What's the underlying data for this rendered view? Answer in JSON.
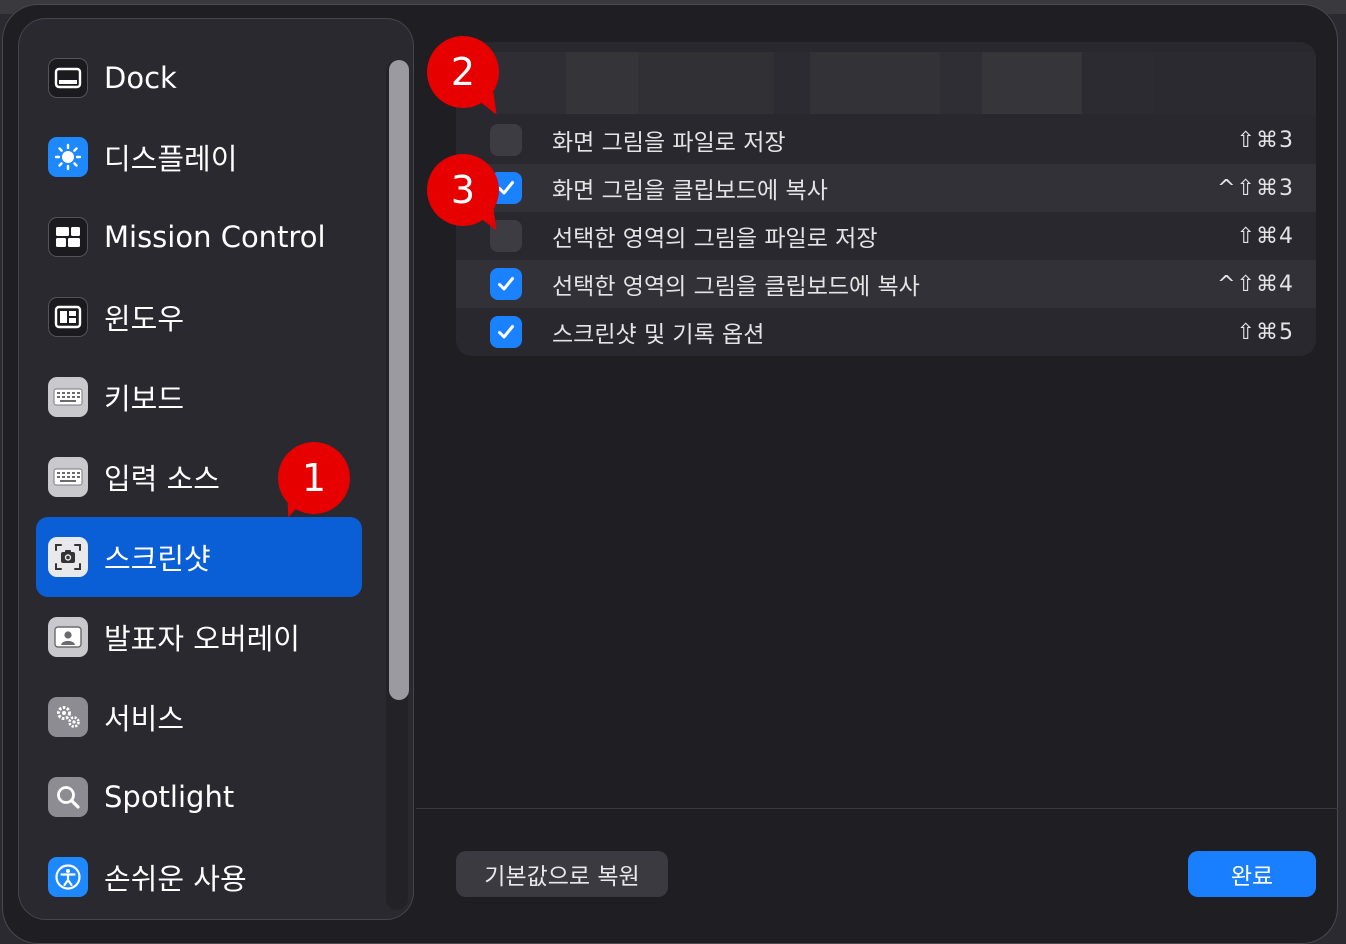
{
  "sidebar": {
    "items": [
      {
        "label": "Dock",
        "icon": "dock-icon",
        "color": "#1b1b1f"
      },
      {
        "label": "디스플레이",
        "icon": "display-brightness-icon",
        "color": "#1e88ff"
      },
      {
        "label": "Mission Control",
        "icon": "mission-control-icon",
        "color": "#1b1b1f"
      },
      {
        "label": "윈도우",
        "icon": "window-icon",
        "color": "#1b1b1f"
      },
      {
        "label": "키보드",
        "icon": "keyboard-icon",
        "color": "#c9c9cd"
      },
      {
        "label": "입력 소스",
        "icon": "keyboard-icon",
        "color": "#c9c9cd"
      },
      {
        "label": "스크린샷",
        "icon": "screenshot-camera-icon",
        "color": "#e9e9ec",
        "selected": true
      },
      {
        "label": "발표자 오버레이",
        "icon": "presenter-overlay-icon",
        "color": "#c9c9cd"
      },
      {
        "label": "서비스",
        "icon": "gears-icon",
        "color": "#8c8c92"
      },
      {
        "label": "Spotlight",
        "icon": "magnifier-icon",
        "color": "#8c8c92"
      },
      {
        "label": "손쉬운 사용",
        "icon": "accessibility-icon",
        "color": "#1e88ff"
      }
    ]
  },
  "shortcuts": {
    "rows": [
      {
        "label": "화면 그림을 파일로 저장",
        "key": "⇧⌘3",
        "checked": false
      },
      {
        "label": "화면 그림을 클립보드에 복사",
        "key": "^⇧⌘3",
        "checked": true
      },
      {
        "label": "선택한 영역의 그림을 파일로 저장",
        "key": "⇧⌘4",
        "checked": false
      },
      {
        "label": "선택한 영역의 그림을 클립보드에 복사",
        "key": "^⇧⌘4",
        "checked": true
      },
      {
        "label": "스크린샷 및 기록 옵션",
        "key": "⇧⌘5",
        "checked": true
      }
    ]
  },
  "footer": {
    "reset_label": "기본값으로 복원",
    "done_label": "완료"
  },
  "annotations": [
    {
      "number": "1"
    },
    {
      "number": "2"
    },
    {
      "number": "3"
    }
  ],
  "colors": {
    "accent": "#1a7fff",
    "selected": "#0a5fd6",
    "marker": "#e60000"
  }
}
